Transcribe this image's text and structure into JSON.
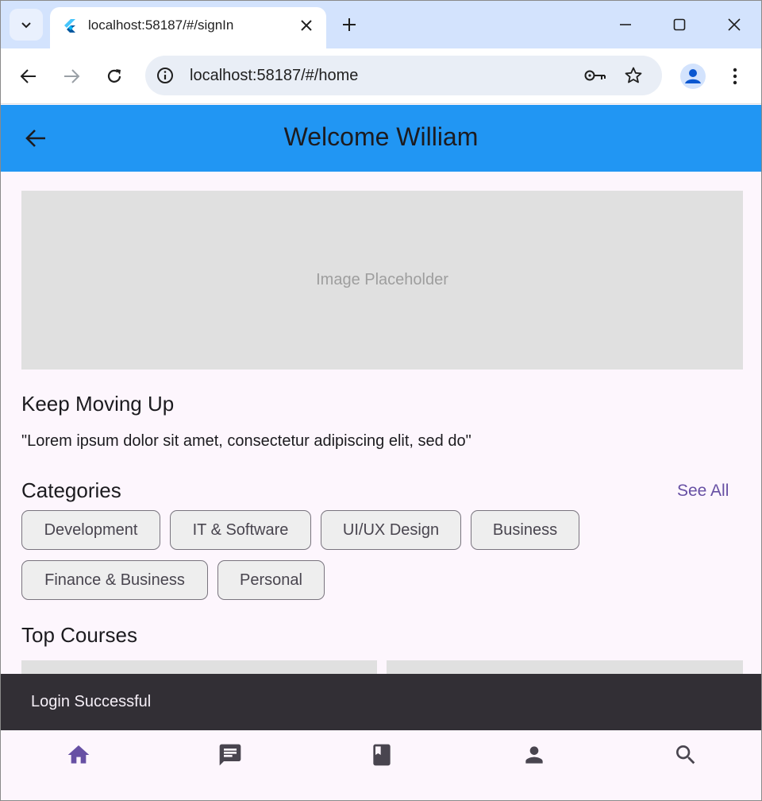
{
  "browser": {
    "tab_title": "localhost:58187/#/signIn",
    "url": "localhost:58187/#/home"
  },
  "app": {
    "title": "Welcome William",
    "hero_placeholder": "Image Placeholder",
    "keep_moving_title": "Keep Moving Up",
    "quote": "\"Lorem ipsum dolor sit amet, consectetur adipiscing elit, sed do\"",
    "categories_title": "Categories",
    "see_all": "See All",
    "categories": [
      "Development",
      "IT & Software",
      "UI/UX Design",
      "Business",
      "Finance & Business",
      "Personal"
    ],
    "top_courses_title": "Top Courses",
    "snackbar": "Login Successful",
    "nav": [
      "home-icon",
      "chat-icon",
      "book-icon",
      "person-icon",
      "search-icon"
    ],
    "colors": {
      "appbar": "#2196f3",
      "accent": "#6750a4",
      "nav_inactive": "#49454f",
      "background": "#fdf6fd"
    }
  }
}
